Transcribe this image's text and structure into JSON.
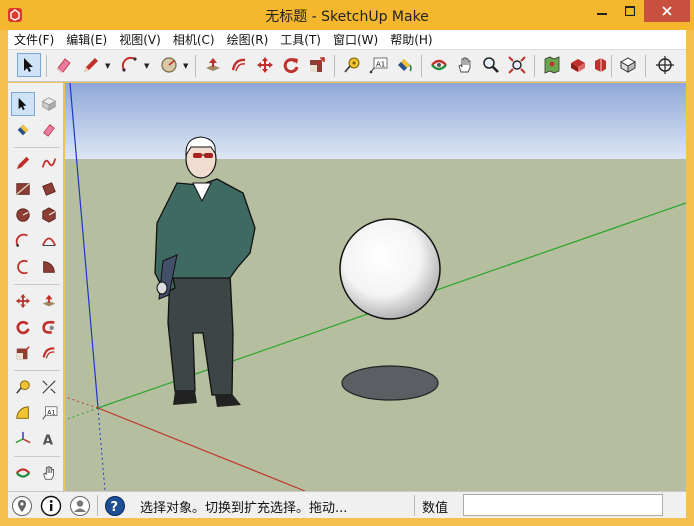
{
  "window": {
    "title": "无标题 - SketchUp Make",
    "controls": [
      "minimize",
      "maximize",
      "close"
    ]
  },
  "menubar": {
    "items": [
      {
        "label": "文件(F)"
      },
      {
        "label": "编辑(E)"
      },
      {
        "label": "视图(V)"
      },
      {
        "label": "相机(C)"
      },
      {
        "label": "绘图(R)"
      },
      {
        "label": "工具(T)"
      },
      {
        "label": "窗口(W)"
      },
      {
        "label": "帮助(H)"
      }
    ]
  },
  "toolbar": {
    "tools": [
      {
        "name": "select",
        "icon": "arrow-cursor-icon",
        "active": true
      },
      {
        "name": "eraser",
        "icon": "eraser-icon"
      },
      {
        "name": "line",
        "icon": "pencil-icon",
        "dropdown": true
      },
      {
        "name": "arc",
        "icon": "arc-icon",
        "dropdown": true
      },
      {
        "name": "shapes",
        "icon": "circle-shape-icon",
        "dropdown": true
      },
      {
        "name": "push-pull",
        "icon": "push-pull-icon"
      },
      {
        "name": "offset",
        "icon": "offset-icon"
      },
      {
        "name": "move",
        "icon": "move-icon"
      },
      {
        "name": "rotate",
        "icon": "rotate-icon"
      },
      {
        "name": "scale",
        "icon": "scale-icon"
      },
      {
        "name": "tape-measure",
        "icon": "tape-measure-icon"
      },
      {
        "name": "text",
        "icon": "text-label-icon"
      },
      {
        "name": "paint-bucket",
        "icon": "paint-bucket-icon"
      },
      {
        "name": "orbit",
        "icon": "orbit-icon"
      },
      {
        "name": "pan",
        "icon": "hand-pan-icon"
      },
      {
        "name": "zoom",
        "icon": "zoom-icon"
      },
      {
        "name": "zoom-extents",
        "icon": "zoom-extents-icon"
      },
      {
        "name": "add-location",
        "icon": "map-location-icon"
      },
      {
        "name": "3d-warehouse",
        "icon": "warehouse-icon"
      },
      {
        "name": "extension-warehouse",
        "icon": "extension-icon"
      },
      {
        "name": "components",
        "icon": "components-icon"
      },
      {
        "name": "position-camera",
        "icon": "crosshair-icon"
      }
    ]
  },
  "statusbar": {
    "hint": "选择对象。切换到扩充选择。拖动...",
    "measurements_label": "数值",
    "measurements_value": ""
  },
  "scene": {
    "sky_top": "#8fa8d8",
    "sky_bottom": "#dce6f4",
    "ground": "#b5bfa0",
    "axis_red": "#c0392b",
    "axis_green": "#2aa52a",
    "axis_blue": "#2233cc"
  }
}
